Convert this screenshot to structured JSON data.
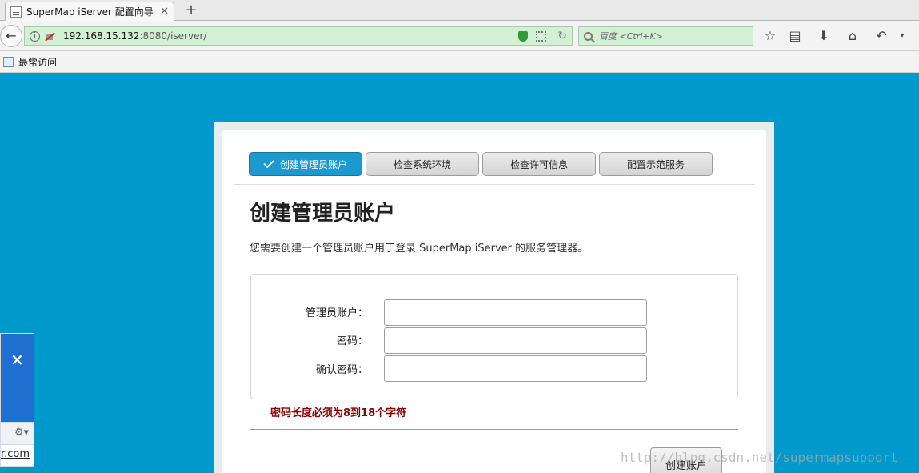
{
  "browser": {
    "tab_title": "SuperMap iServer 配置向导",
    "tab_close": "✕",
    "new_tab": "+",
    "url_host": "192.168.15.132",
    "url_path": ":8080/iserver/",
    "search_placeholder": "百度 <Ctrl+K>",
    "bookmark_label": "最常访问"
  },
  "wizard": {
    "steps": [
      {
        "label": "创建管理员账户",
        "active": true
      },
      {
        "label": "检查系统环境",
        "active": false
      },
      {
        "label": "检查许可信息",
        "active": false
      },
      {
        "label": "配置示范服务",
        "active": false
      }
    ],
    "heading": "创建管理员账户",
    "description": "您需要创建一个管理员账户用于登录 SuperMap iServer 的服务管理器。",
    "fields": [
      {
        "label": "管理员账户：",
        "value": ""
      },
      {
        "label": "密码：",
        "value": ""
      },
      {
        "label": "确认密码：",
        "value": ""
      }
    ],
    "error": "密码长度必须为8到18个字符",
    "submit_label": "创建账户"
  },
  "side_panel": {
    "close": "×",
    "tools": "⚙▾",
    "link_text": "r.com"
  },
  "watermark": "http://blog.csdn.net/supermapsupport",
  "colors": {
    "page_background": "#0099cc",
    "active_step": "#1c9ad0",
    "error_text": "#8b0000"
  }
}
